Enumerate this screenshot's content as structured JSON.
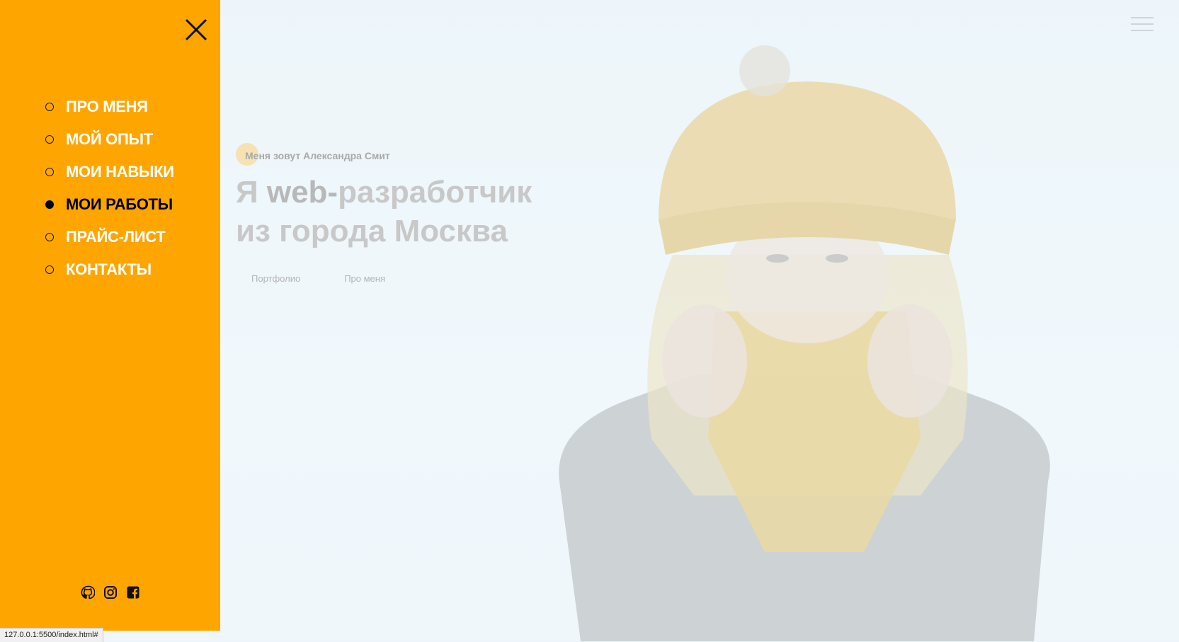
{
  "hero": {
    "intro": "Меня зовут Александра Смит",
    "headline_pre": "Я ",
    "headline_accent": "web-",
    "headline_rest": "разработчик",
    "headline_line2": "из города Москва",
    "buttons": [
      "Портфолио",
      "Про меня"
    ]
  },
  "sidebar": {
    "items": [
      {
        "label": "ПРО МЕНЯ",
        "active": false
      },
      {
        "label": "МОЙ ОПЫТ",
        "active": false
      },
      {
        "label": "МОИ НАВЫКИ",
        "active": false
      },
      {
        "label": "МОИ РАБОТЫ",
        "active": true
      },
      {
        "label": "ПРАЙС-ЛИСТ",
        "active": false
      },
      {
        "label": "КОНТАКТЫ",
        "active": false
      }
    ],
    "socials": [
      "github-icon",
      "instagram-icon",
      "facebook-icon"
    ]
  },
  "status_url": "127.0.0.1:5500/index.html#",
  "colors": {
    "sidebar_bg": "#ffa500",
    "menu_text": "#ffffff",
    "menu_active": "#000000"
  }
}
